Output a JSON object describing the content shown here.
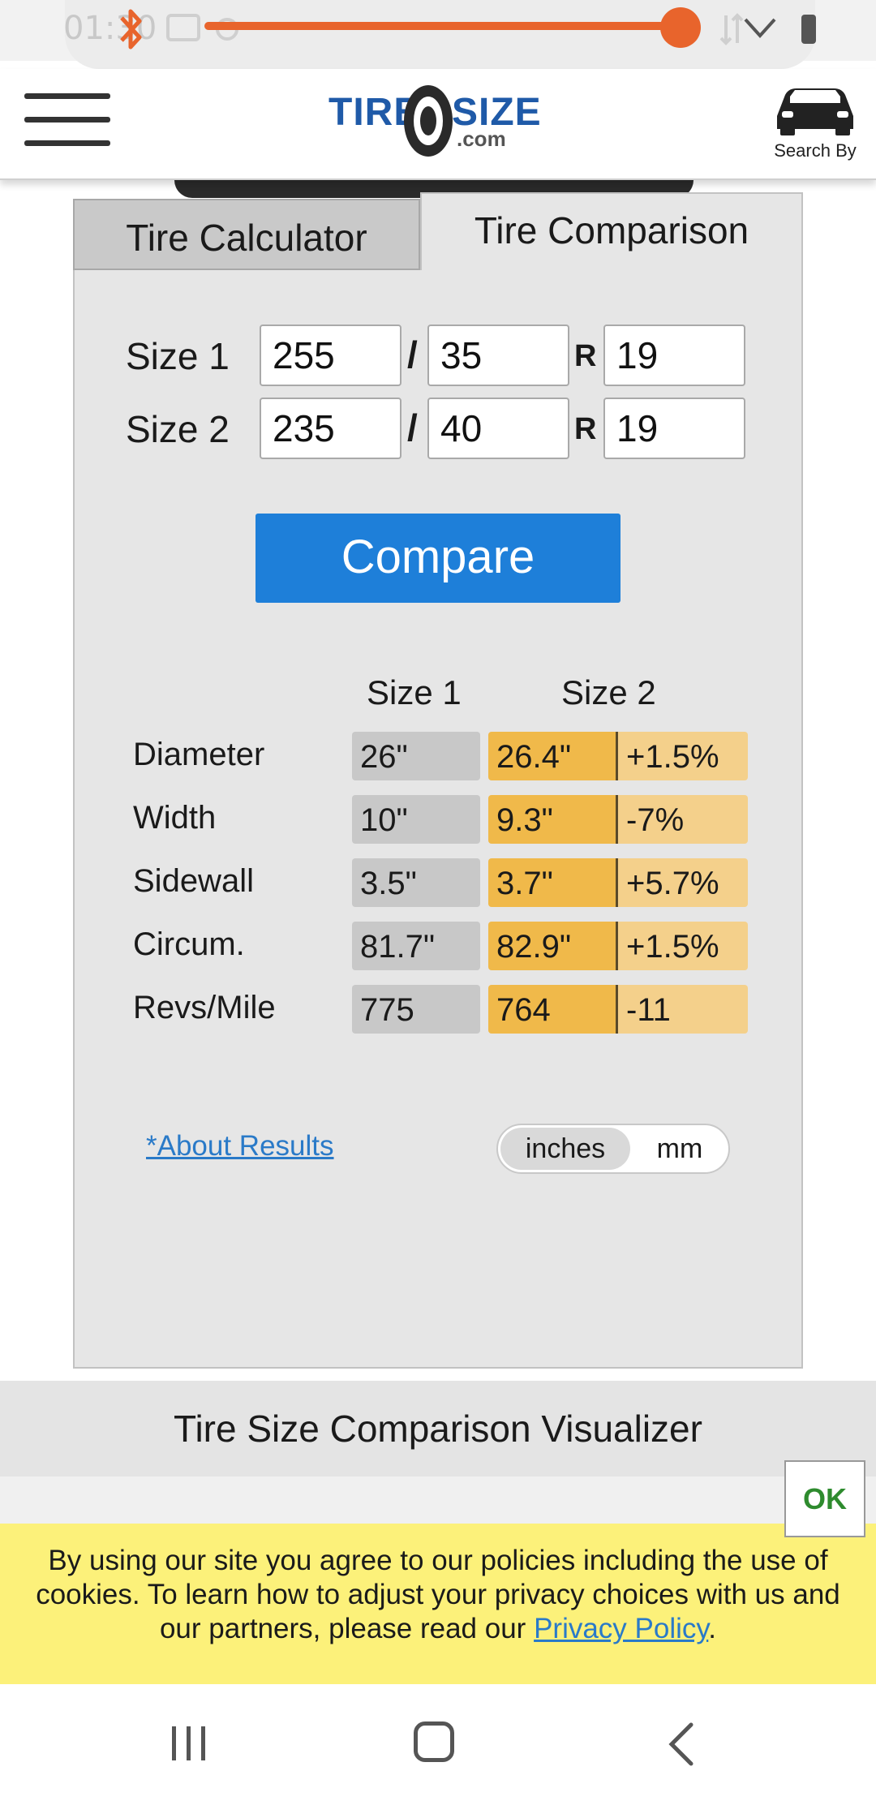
{
  "status_bar": {
    "time": "01:30",
    "volume_level": 0.95,
    "accent_color": "#e8642c"
  },
  "header": {
    "logo": {
      "word1": "TIRE",
      "word2": "SIZE",
      "suffix": ".com"
    },
    "search_by_label": "Search By",
    "icons": [
      "hamburger-menu-icon",
      "car-icon"
    ]
  },
  "tabs": [
    {
      "label": "Tire Calculator",
      "active": false
    },
    {
      "label": "Tire Comparison",
      "active": true
    }
  ],
  "sizes": [
    {
      "label": "Size 1",
      "width": "255",
      "aspect": "35",
      "rim": "19"
    },
    {
      "label": "Size 2",
      "width": "235",
      "aspect": "40",
      "rim": "19"
    }
  ],
  "separators": {
    "slash": "/",
    "r": "R"
  },
  "compare_button": "Compare",
  "results": {
    "col_size1": "Size 1",
    "col_size2": "Size 2",
    "rows": [
      {
        "label": "Diameter",
        "size1": "26\"",
        "size2": "26.4\"",
        "diff": "+1.5%"
      },
      {
        "label": "Width",
        "size1": "10\"",
        "size2": "9.3\"",
        "diff": "-7%"
      },
      {
        "label": "Sidewall",
        "size1": "3.5\"",
        "size2": "3.7\"",
        "diff": "+5.7%"
      },
      {
        "label": "Circum.",
        "size1": "81.7\"",
        "size2": "82.9\"",
        "diff": "+1.5%"
      },
      {
        "label": "Revs/Mile",
        "size1": "775",
        "size2": "764",
        "diff": "-11"
      }
    ]
  },
  "about_results": "*About Results",
  "units": {
    "inches": "inches",
    "mm": "mm",
    "selected": "inches"
  },
  "visualizer_title": "Tire Size Comparison Visualizer",
  "cookie": {
    "text_before": "By using our site you agree to our policies including the use of cookies. To learn how to adjust your privacy choices with us and our partners, please read our ",
    "link": "Privacy Policy",
    "text_after": ".",
    "ok": "OK"
  },
  "colors": {
    "brand_blue": "#1f5aa8",
    "button_blue": "#1e7fd9",
    "size2_orange": "#f0b94a",
    "diff_light": "#f4d08b",
    "cookie_yellow": "#fcf17a",
    "ok_green": "#2e8b2e"
  },
  "nav": {
    "icons": [
      "recents-icon",
      "home-icon",
      "back-icon"
    ]
  }
}
